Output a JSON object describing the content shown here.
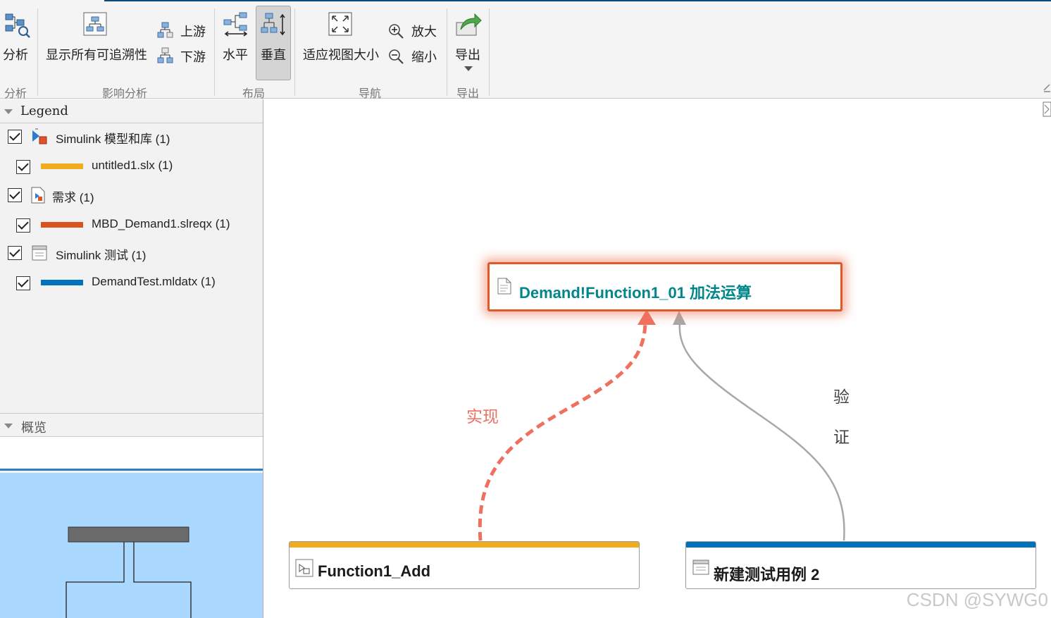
{
  "toolstrip": {
    "analyze_label": "分析",
    "show_all_label": "显示所有可追溯性",
    "upstream_label": "上游",
    "downstream_label": "下游",
    "horizontal_label": "水平",
    "vertical_label": "垂直",
    "fit_view_label": "适应视图大小",
    "zoom_in_label": "放大",
    "zoom_out_label": "缩小",
    "export_label": "导出",
    "groups": {
      "analyze": "分析",
      "impact": "影响分析",
      "layout": "布局",
      "navigation": "导航",
      "export": "导出"
    }
  },
  "legend": {
    "title": "Legend",
    "items": [
      {
        "label": "Simulink 模型和库 (1)",
        "checked": true
      },
      {
        "label": "untitled1.slx (1)",
        "color": "#f0ac1c",
        "checked": true
      },
      {
        "label": "需求 (1)",
        "checked": true
      },
      {
        "label": "MBD_Demand1.slreqx (1)",
        "color": "#d9531e",
        "checked": true
      },
      {
        "label": "Simulink 测试 (1)",
        "checked": true
      },
      {
        "label": "DemandTest.mldatx (1)",
        "color": "#0072bd",
        "checked": true
      }
    ]
  },
  "overview": {
    "title": "概览"
  },
  "graph": {
    "requirement_node": {
      "title": "Demand!Function1_01 加法运算",
      "color": "#00868b",
      "border": "#e05a26"
    },
    "model_node": {
      "title": "Function1_Add",
      "bar_color": "#f0ac1c"
    },
    "test_node": {
      "title": "新建测试用例 2",
      "bar_color": "#0072bd"
    },
    "edge_implements": {
      "label": "实现",
      "color": "#f07060"
    },
    "edge_verifies": {
      "label": "验\n\n证",
      "line1": "验",
      "line2": "证",
      "color": "#a8a8a8"
    }
  },
  "watermark": "CSDN @SYWG0"
}
